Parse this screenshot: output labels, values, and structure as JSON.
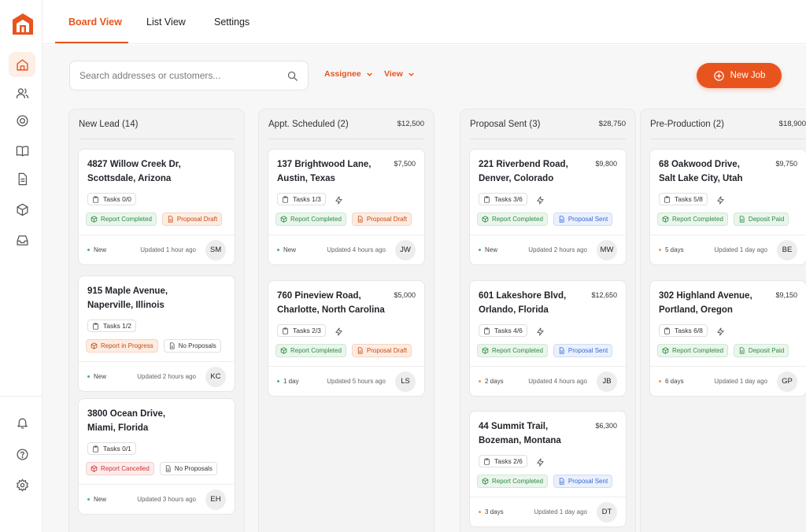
{
  "tabs": [
    {
      "label": "Board View",
      "active": true
    },
    {
      "label": "List View",
      "active": false
    },
    {
      "label": "Settings",
      "active": false
    }
  ],
  "search": {
    "placeholder": "Search addresses or customers..."
  },
  "filters": {
    "assignee": "Assignee",
    "view": "View"
  },
  "new_job_label": "New Job",
  "sidebar": {
    "top_icons": [
      "home-icon",
      "users-icon",
      "target-icon",
      "book-icon",
      "document-icon",
      "box-icon",
      "inbox-icon"
    ],
    "bottom_icons": [
      "bell-icon",
      "help-icon",
      "settings-icon"
    ]
  },
  "colors": {
    "accent": "#e8541e",
    "green": "#2f8a45",
    "blue": "#3a68d1",
    "red": "#cf3333"
  },
  "columns": [
    {
      "title": "New Lead (14)",
      "total": "",
      "cards": [
        {
          "line1": "4827 Willow Creek Dr,",
          "line2": "Scottsdale, Arizona",
          "price": "",
          "tasks": "Tasks 0/0",
          "bolt": false,
          "badge1": {
            "text": "Report Completed",
            "type": "green"
          },
          "badge2": {
            "text": "Proposal Draft",
            "type": "orange"
          },
          "status": "New",
          "status_color": "green",
          "updated": "Updated 1 hour ago",
          "initials": "SM"
        },
        {
          "line1": "915 Maple Avenue,",
          "line2": "Naperville, Illinois",
          "price": "",
          "tasks": "Tasks 1/2",
          "bolt": false,
          "badge1": {
            "text": "Report in Progress",
            "type": "orange"
          },
          "badge2": {
            "text": "No Proposals",
            "type": "gray"
          },
          "status": "New",
          "status_color": "green",
          "updated": "Updated 2 hours ago",
          "initials": "KC"
        },
        {
          "line1": "3800 Ocean Drive,",
          "line2": "Miami, Florida",
          "price": "",
          "tasks": "Tasks 0/1",
          "bolt": false,
          "badge1": {
            "text": "Report Cancelled",
            "type": "red"
          },
          "badge2": {
            "text": "No Proposals",
            "type": "gray"
          },
          "status": "New",
          "status_color": "green",
          "updated": "Updated 3 hours ago",
          "initials": "EH"
        }
      ]
    },
    {
      "title": "Appt. Scheduled (2)",
      "total": "$12,500",
      "cards": [
        {
          "line1": "137 Brightwood Lane,",
          "line2": "Austin, Texas",
          "price": "$7,500",
          "tasks": "Tasks 1/3",
          "bolt": true,
          "badge1": {
            "text": "Report Completed",
            "type": "green"
          },
          "badge2": {
            "text": "Proposal Draft",
            "type": "orange"
          },
          "status": "New",
          "status_color": "green",
          "updated": "Updated 4 hours ago",
          "initials": "JW"
        },
        {
          "line1": "760 Pineview Road,",
          "line2": "Charlotte, North Carolina",
          "price": "$5,000",
          "tasks": "Tasks 2/3",
          "bolt": true,
          "badge1": {
            "text": "Report Completed",
            "type": "green"
          },
          "badge2": {
            "text": "Proposal Draft",
            "type": "orange"
          },
          "status": "1 day",
          "status_color": "green",
          "updated": "Updated 5 hours ago",
          "initials": "LS"
        }
      ]
    },
    {
      "title": "Proposal Sent (3)",
      "total": "$28,750",
      "cards": [
        {
          "line1": "221 Riverbend Road,",
          "line2": "Denver, Colorado",
          "price": "$9,800",
          "tasks": "Tasks 3/6",
          "bolt": true,
          "badge1": {
            "text": "Report Completed",
            "type": "green"
          },
          "badge2": {
            "text": "Proposal Sent",
            "type": "blue"
          },
          "status": "New",
          "status_color": "green",
          "updated": "Updated 2 hours ago",
          "initials": "MW"
        },
        {
          "line1": "601 Lakeshore Blvd,",
          "line2": "Orlando, Florida",
          "price": "$12,650",
          "tasks": "Tasks 4/6",
          "bolt": true,
          "badge1": {
            "text": "Report Completed",
            "type": "green"
          },
          "badge2": {
            "text": "Proposal Sent",
            "type": "blue"
          },
          "status": "2 days",
          "status_color": "orange",
          "updated": "Updated 4 hours ago",
          "initials": "JB"
        },
        {
          "line1": "44 Summit Trail,",
          "line2": "Bozeman, Montana",
          "price": "$6,300",
          "tasks": "Tasks 2/6",
          "bolt": true,
          "badge1": {
            "text": "Report Completed",
            "type": "green"
          },
          "badge2": {
            "text": "Proposal Sent",
            "type": "blue"
          },
          "status": "3 days",
          "status_color": "orange",
          "updated": "Updated 1 day ago",
          "initials": "DT"
        }
      ]
    },
    {
      "title": "Pre-Production (2)",
      "total": "$18,900",
      "cards": [
        {
          "line1": "68 Oakwood Drive,",
          "line2": "Salt Lake City, Utah",
          "price": "$9,750",
          "tasks": "Tasks 5/8",
          "bolt": true,
          "badge1": {
            "text": "Report Completed",
            "type": "green"
          },
          "badge2": {
            "text": "Deposit Paid",
            "type": "green"
          },
          "status": "5 days",
          "status_color": "orange",
          "updated": "Updated 1 day ago",
          "initials": "BE"
        },
        {
          "line1": "302 Highland Avenue,",
          "line2": "Portland, Oregon",
          "price": "$9,150",
          "tasks": "Tasks 6/8",
          "bolt": true,
          "badge1": {
            "text": "Report Completed",
            "type": "green"
          },
          "badge2": {
            "text": "Deposit Paid",
            "type": "green"
          },
          "status": "6 days",
          "status_color": "orange",
          "updated": "Updated 1 day ago",
          "initials": "GP"
        }
      ]
    }
  ]
}
